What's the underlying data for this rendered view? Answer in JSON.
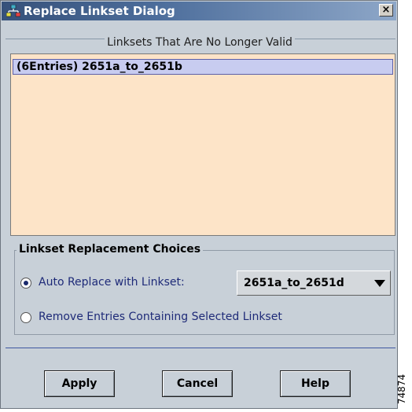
{
  "window": {
    "title": "Replace Linkset Dialog",
    "close_label": "×"
  },
  "invalid_section": {
    "label": "Linksets That Are No Longer Valid",
    "items": [
      "(6Entries) 2651a_to_2651b"
    ]
  },
  "replacement": {
    "label": "Linkset Replacement Choices",
    "auto_replace_label": "Auto Replace with Linkset:",
    "auto_replace_selected": true,
    "linkset_value": "2651a_to_2651d",
    "remove_label": "Remove Entries Containing Selected Linkset",
    "remove_selected": false
  },
  "buttons": {
    "apply": "Apply",
    "cancel": "Cancel",
    "help": "Help"
  },
  "figure_tag": "74874",
  "colors": {
    "dialog_bg": "#c8d0d8",
    "list_bg": "#fde4c8",
    "selected_row": "#c8ccf0",
    "title_bar": "#4d6e9c"
  },
  "icons": {
    "title": "network-tree-icon",
    "combo": "triangle-down-icon"
  }
}
